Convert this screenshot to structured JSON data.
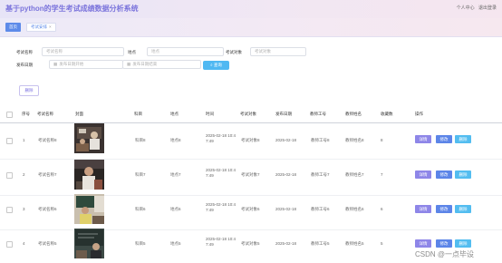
{
  "header": {
    "title": "基于python的学生考试成绩数据分析系统",
    "links": [
      "个人中心",
      "退出登录"
    ]
  },
  "tabs": [
    {
      "label": "首页",
      "active": true
    },
    {
      "label": "考试安排",
      "active": false,
      "close": "×"
    }
  ],
  "filters": {
    "exam_name": {
      "label": "考试名称",
      "placeholder": "考试名称"
    },
    "location": {
      "label": "地点",
      "placeholder": "地点"
    },
    "exam_target": {
      "label": "考试对象",
      "placeholder": "考试对象"
    },
    "publish_date": {
      "label": "发布日期",
      "start_placeholder": "发布日期开始",
      "end_placeholder": "发布日期结束"
    },
    "search_label": "查询"
  },
  "toolbar": {
    "delete_label": "删除"
  },
  "table": {
    "headers": [
      "序号",
      "考试名称",
      "封面",
      "科目",
      "地点",
      "时间",
      "考试对象",
      "发布日期",
      "教师工号",
      "教师姓名",
      "收藏数",
      "操作"
    ],
    "rows": [
      {
        "index": "1",
        "name": "考试名称8",
        "subject": "科目8",
        "location": "地点8",
        "time_date": "2025-02-18 10:4",
        "time_clock": "7:49",
        "target": "考试对象8",
        "publish": "2025-02-18",
        "teacher_id": "教师工号8",
        "teacher_name": "教师姓名8",
        "favorites": "8"
      },
      {
        "index": "2",
        "name": "考试名称7",
        "subject": "科目7",
        "location": "地点7",
        "time_date": "2025-02-18 10:4",
        "time_clock": "7:49",
        "target": "考试对象7",
        "publish": "2025-02-18",
        "teacher_id": "教师工号7",
        "teacher_name": "教师姓名7",
        "favorites": "7"
      },
      {
        "index": "3",
        "name": "考试名称6",
        "subject": "科目6",
        "location": "地点6",
        "time_date": "2025-02-18 10:4",
        "time_clock": "7:49",
        "target": "考试对象6",
        "publish": "2025-02-18",
        "teacher_id": "教师工号6",
        "teacher_name": "教师姓名6",
        "favorites": "6"
      },
      {
        "index": "4",
        "name": "考试名称5",
        "subject": "科目5",
        "location": "地点5",
        "time_date": "2025-02-18 10:4",
        "time_clock": "7:49",
        "target": "考试对象5",
        "publish": "2025-02-18",
        "teacher_id": "教师工号5",
        "teacher_name": "教师姓名5",
        "favorites": "5"
      }
    ],
    "actions": {
      "view": "详情",
      "edit": "修改",
      "delete": "删除"
    }
  },
  "watermark": "CSDN @一点毕设",
  "colors": {
    "accent": "#7b74dc",
    "primary": "#5c85e8",
    "info": "#53bdf0"
  }
}
